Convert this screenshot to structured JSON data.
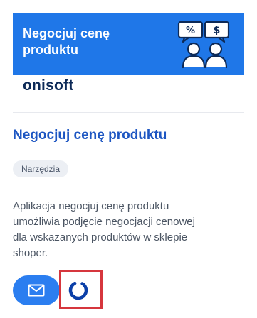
{
  "banner": {
    "title_line1": "Negocjuj cenę",
    "title_line2": "produktu",
    "logo": "onisoft",
    "colors": {
      "background": "#1f77e8",
      "logo": "#0d2a57"
    },
    "icon": "negotiation-people-icon"
  },
  "app": {
    "title": "Negocjuj cenę produktu",
    "tag": "Narzędzia",
    "description_lines": [
      "Aplikacja negocjuj cenę produktu",
      "umożliwia podjęcie negocjacji cenowej",
      "dla wskazanych produktów w sklepie",
      "shoper."
    ]
  },
  "actions": {
    "mail_icon": "mail-icon",
    "loader_icon": "loading-spinner-icon",
    "colors": {
      "mail_button": "#2b7ef0",
      "highlight": "#d6363d"
    }
  }
}
